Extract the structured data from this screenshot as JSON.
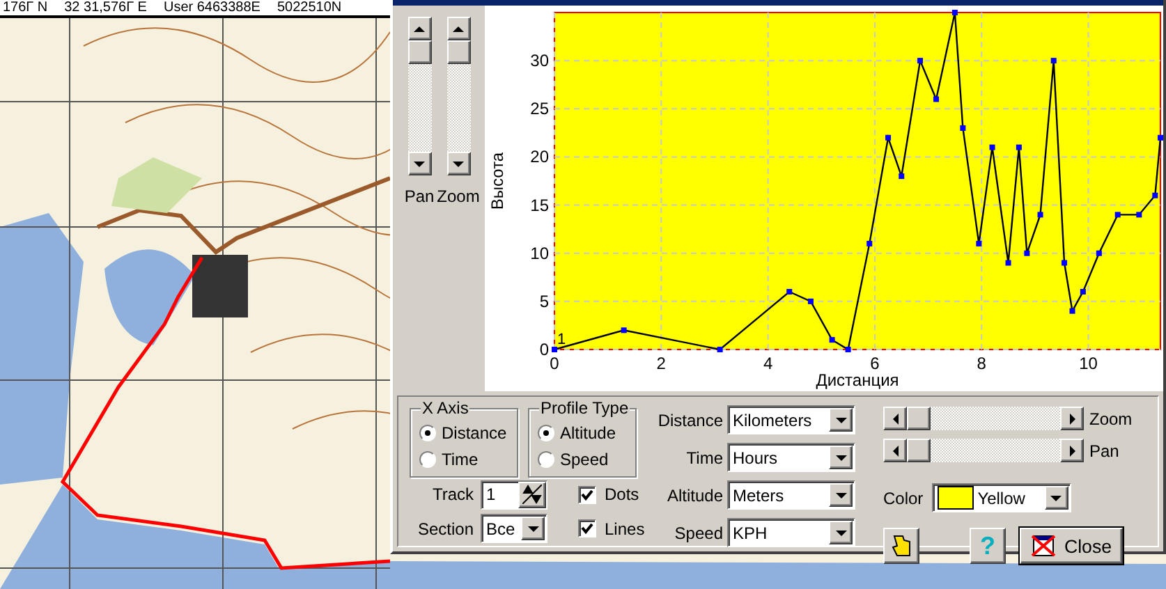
{
  "status_bar": {
    "latitude": "176Г N",
    "longitude": "32 31,576Г E",
    "user_east": "User 6463388E",
    "user_north": "5022510N"
  },
  "side_sliders": [
    {
      "label": "Pan"
    },
    {
      "label": "Zoom"
    }
  ],
  "chart": {
    "chart_data": {
      "type": "line",
      "xlabel": "Дистанция",
      "ylabel": "Высота",
      "x": [
        0,
        1.3,
        3.1,
        4.4,
        4.8,
        5.2,
        5.5,
        5.9,
        6.25,
        6.5,
        6.85,
        7.15,
        7.5,
        7.65,
        7.95,
        8.2,
        8.5,
        8.7,
        8.85,
        9.1,
        9.35,
        9.55,
        9.7,
        9.9,
        10.2,
        10.55,
        10.95,
        11.25,
        11.35
      ],
      "values": [
        0,
        2,
        0,
        6,
        5,
        1,
        0,
        11,
        22,
        18,
        30,
        26,
        35,
        23,
        11,
        21,
        9,
        21,
        10,
        14,
        30,
        9,
        4,
        6,
        10,
        14,
        14,
        16,
        22
      ],
      "xlim": [
        0,
        11.35
      ],
      "ylim": [
        0,
        35
      ],
      "grid": true,
      "marker": "square",
      "xticks": [
        0,
        2,
        4,
        6,
        8,
        10
      ],
      "yticks": [
        0,
        5,
        10,
        15,
        20,
        25,
        30
      ],
      "annotations": [
        {
          "x": 0,
          "y": 0,
          "text": "1"
        }
      ]
    }
  },
  "x_axis": {
    "title": "X Axis",
    "options": [
      {
        "label": "Distance",
        "selected": true
      },
      {
        "label": "Time",
        "selected": false
      }
    ]
  },
  "profile_type": {
    "title": "Profile Type",
    "options": [
      {
        "label": "Altitude",
        "selected": true
      },
      {
        "label": "Speed",
        "selected": false
      }
    ]
  },
  "track": {
    "label": "Track",
    "value": "1"
  },
  "section": {
    "label": "Section",
    "value": "Все"
  },
  "checkboxes": [
    {
      "label": "Dots",
      "checked": true
    },
    {
      "label": "Lines",
      "checked": true
    }
  ],
  "units": [
    {
      "label": "Distance",
      "value": "Kilometers"
    },
    {
      "label": "Time",
      "value": "Hours"
    },
    {
      "label": "Altitude",
      "value": "Meters"
    },
    {
      "label": "Speed",
      "value": "KPH"
    }
  ],
  "bottom_sliders": [
    {
      "label": "Zoom"
    },
    {
      "label": "Pan"
    }
  ],
  "color": {
    "label": "Color",
    "value": "Yellow",
    "color": "#ffff00"
  },
  "buttons": [
    {
      "kind": "hand"
    },
    {
      "kind": "help",
      "label": "?"
    },
    {
      "kind": "close",
      "label": "Close"
    }
  ]
}
